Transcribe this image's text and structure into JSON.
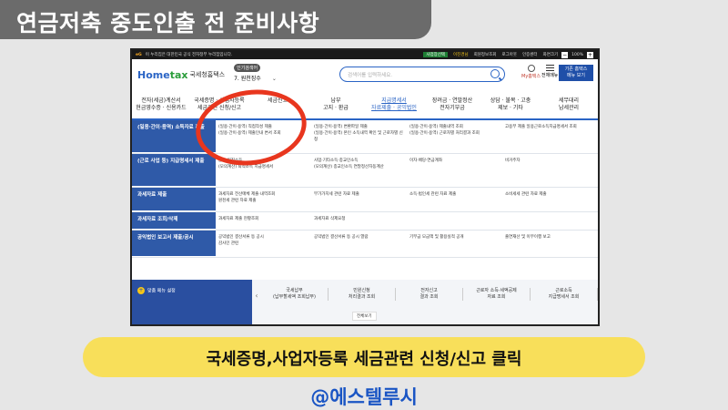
{
  "slide_title": "연금저축 중도인출 전 준비사항",
  "caption": "국세증명,사업자등록 세금관련 신청/신고 클릭",
  "handle": "@에스텔루시",
  "colors": {
    "title_bg": "#6b6b6b",
    "caption_bg": "#f8df5a",
    "handle": "#1a55c4",
    "highlight_circle": "#e8361e",
    "accent": "#2a64c5"
  },
  "gov_bar": {
    "logo": "eG",
    "notice": "이 누리집은 대한민국 공식 전자정부 누리집입니다.",
    "links": [
      "사업장선택",
      "이진경님",
      "회원정보조회",
      "로그아웃",
      "인증센터",
      "화면크기"
    ],
    "zoom": "100%"
  },
  "header": {
    "logo_home": "Home",
    "logo_tax": "tax",
    "logo_agency": "국세청홈택스",
    "popular_badge": "인기검색어",
    "popular_item": "7. 원천징수",
    "search_placeholder": "검색어를 입력하세요.",
    "my_home": "My홈택스",
    "all_menu": "전체메뉴",
    "basic_menu_line1": "기존 홈택스",
    "basic_menu_line2": "메뉴 보기"
  },
  "gnb": [
    {
      "l1": "전자(세금)계산서",
      "l2": "현금영수증 · 신용카드"
    },
    {
      "l1": "국세증명 · 사업자등록",
      "l2": "세금관련 신청/신고"
    },
    {
      "l1": "세금신고",
      "l2": ""
    },
    {
      "l1": "납부",
      "l2": "고지 · 환급"
    },
    {
      "l1": "지급명세서",
      "l2": "자료제출 · 공익법인"
    },
    {
      "l1": "장려금 · 연말정산",
      "l2": "전자기부금"
    },
    {
      "l1": "상담 · 불복 · 고충",
      "l2": "제보 · 기타"
    },
    {
      "l1": "세무대리",
      "l2": "납세관리"
    }
  ],
  "rows": [
    {
      "label": "(일용·간이·용역) 소득자료 제출",
      "cols": [
        "(일용·간이·용역) 직접작성 제출\n(일용·간이·용역) 제출인내 변서 조회",
        "(일용·간이·용역) 변환파일 제출\n(일용·간이·용역) 본인 소득내역 확인 및 근로자별 신청",
        "(일용·간이·용역) 제출내역 조회\n(일용·간이·용역) 근로자별 처리결과 조회",
        "고용부 제출 일용근로소득지급명세서 조회"
      ]
    },
    {
      "label": "(근로 사업 등) 지급명세서 제출",
      "cols": [
        "근로·퇴직소득\n(모의계산) 퇴직소득 지급명세서",
        "사업·기타소득·종교인소득\n(모의계산) 종교인소득 연말정산자동계산",
        "이자·배당·연금계좌",
        "비거주자"
      ]
    },
    {
      "label": "과세자료 제출",
      "cols": [
        "과세자료 전산매체 제출·내역조회\n원천세 관련 자료 제출",
        "부가가치세 관련 자료 제출",
        "소득·법인세 관련 자료 제출",
        "소비세세 관련 자료 제출"
      ]
    },
    {
      "label": "과세자료 조회/삭제",
      "cols": [
        "과세자료 제출 현황조회",
        "과세자료 삭제요청",
        "",
        ""
      ]
    },
    {
      "label": "공익법인 보고서 제출/공시",
      "cols": [
        "공익법인 결산서류 등 공시\n감사인 관련",
        "공익법인 결산서류 등 공시 열람",
        "기부금 모금액 및 활용실적 공개",
        "출연재산 및 이무이행 보고"
      ]
    }
  ],
  "quick": {
    "button": "맞춤 메뉴 설정",
    "items": [
      {
        "l1": "국세납부",
        "l2": "(납부할세액 조회납부)"
      },
      {
        "l1": "민원신청",
        "l2": "처리결과 조회"
      },
      {
        "l1": "전자신고",
        "l2": "결과 조회"
      },
      {
        "l1": "근로자 소득·세액공제",
        "l2": "자료 조회"
      },
      {
        "l1": "근로소득",
        "l2": "지급명세서 조회"
      }
    ],
    "view_all": "전체보기"
  }
}
